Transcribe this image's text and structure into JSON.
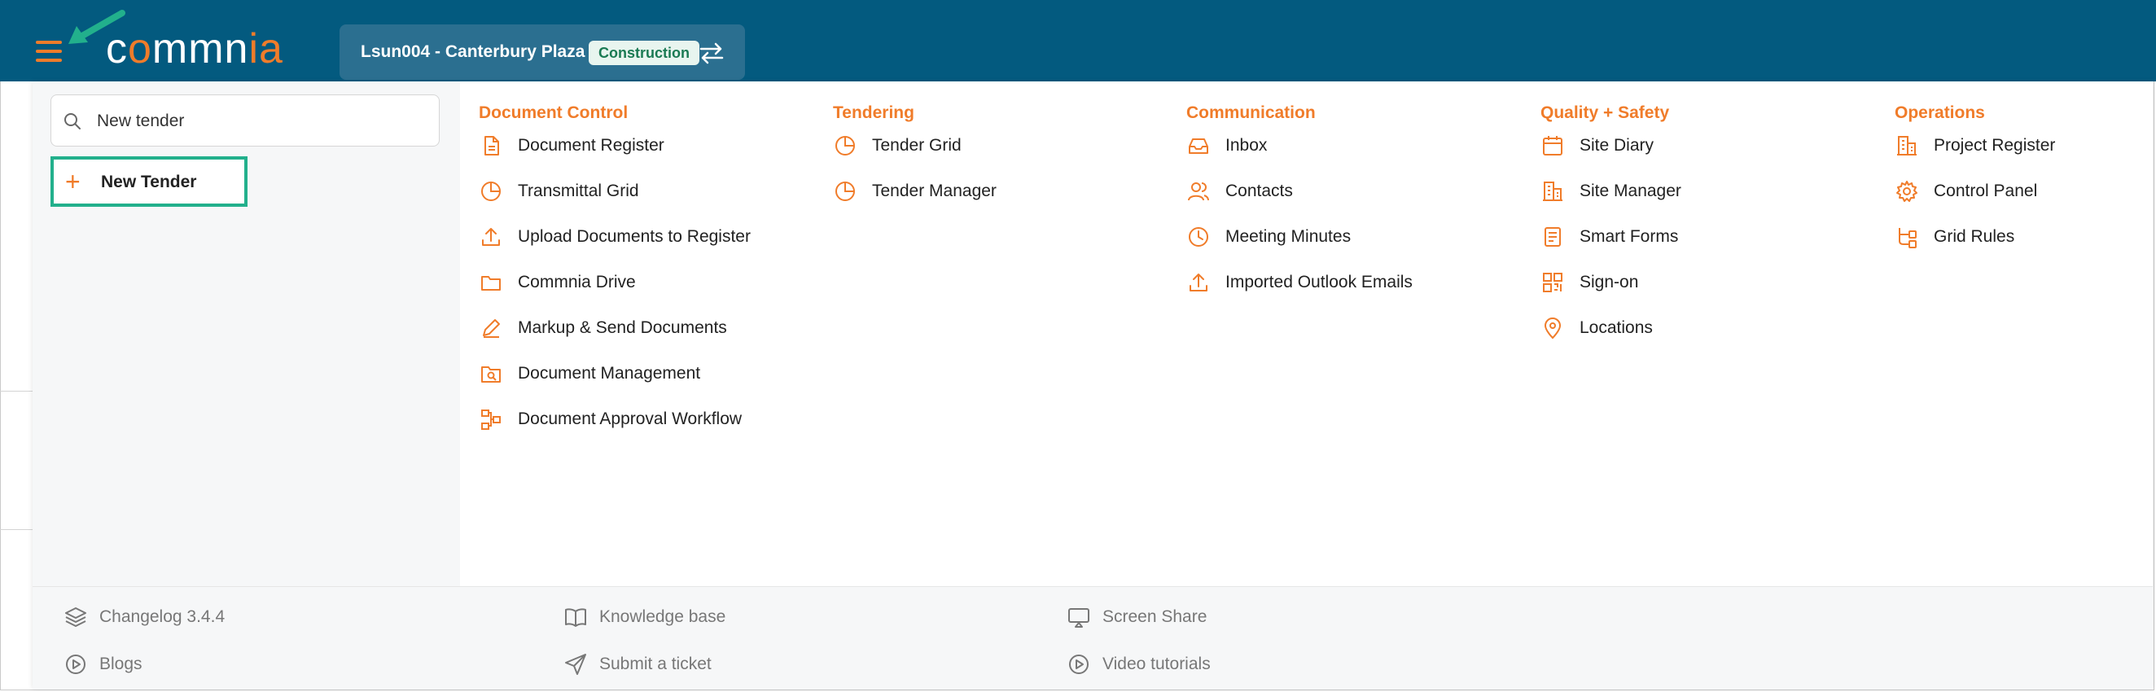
{
  "header": {
    "logo_left": "c",
    "logo_o": "o",
    "logo_mid": "mmn",
    "logo_right": "ia",
    "project_name": "Lsun004 - Canterbury Plaza",
    "project_badge": "Construction"
  },
  "search": {
    "value": "New tender",
    "result_label": "New Tender"
  },
  "columns": [
    {
      "title": "Document Control",
      "items": [
        {
          "label": "Document Register",
          "icon": "document-icon"
        },
        {
          "label": "Transmittal Grid",
          "icon": "pie-chart-icon"
        },
        {
          "label": "Upload Documents to Register",
          "icon": "upload-icon"
        },
        {
          "label": "Commnia Drive",
          "icon": "folder-icon"
        },
        {
          "label": "Markup & Send Documents",
          "icon": "pen-icon"
        },
        {
          "label": "Document Management",
          "icon": "folder-search-icon"
        },
        {
          "label": "Document Approval Workflow",
          "icon": "workflow-icon"
        }
      ]
    },
    {
      "title": "Tendering",
      "items": [
        {
          "label": "Tender Grid",
          "icon": "pie-chart-icon"
        },
        {
          "label": "Tender Manager",
          "icon": "pie-chart-icon"
        }
      ]
    },
    {
      "title": "Communication",
      "items": [
        {
          "label": "Inbox",
          "icon": "inbox-icon"
        },
        {
          "label": "Contacts",
          "icon": "users-icon"
        },
        {
          "label": "Meeting Minutes",
          "icon": "clock-icon"
        },
        {
          "label": "Imported Outlook Emails",
          "icon": "upload-icon"
        }
      ]
    },
    {
      "title": "Quality + Safety",
      "items": [
        {
          "label": "Site Diary",
          "icon": "calendar-icon"
        },
        {
          "label": "Site Manager",
          "icon": "building-icon"
        },
        {
          "label": "Smart Forms",
          "icon": "form-icon"
        },
        {
          "label": "Sign-on",
          "icon": "qr-code-icon"
        },
        {
          "label": "Locations",
          "icon": "map-pin-icon"
        }
      ]
    },
    {
      "title": "Operations",
      "items": [
        {
          "label": "Project Register",
          "icon": "building-icon"
        },
        {
          "label": "Control Panel",
          "icon": "gear-icon"
        },
        {
          "label": "Grid Rules",
          "icon": "rules-icon"
        }
      ]
    }
  ],
  "footer": [
    {
      "label": "Changelog 3.4.4",
      "icon": "layers-icon"
    },
    {
      "label": "Blogs",
      "icon": "play-circle-icon"
    },
    {
      "label": "Knowledge base",
      "icon": "book-icon"
    },
    {
      "label": "Submit a ticket",
      "icon": "send-icon"
    },
    {
      "label": "Screen Share",
      "icon": "screen-share-icon"
    },
    {
      "label": "Video tutorials",
      "icon": "play-circle-icon"
    }
  ],
  "colors": {
    "header_bg": "#035a7f",
    "accent": "#f07c2a",
    "highlight": "#22b08c"
  }
}
